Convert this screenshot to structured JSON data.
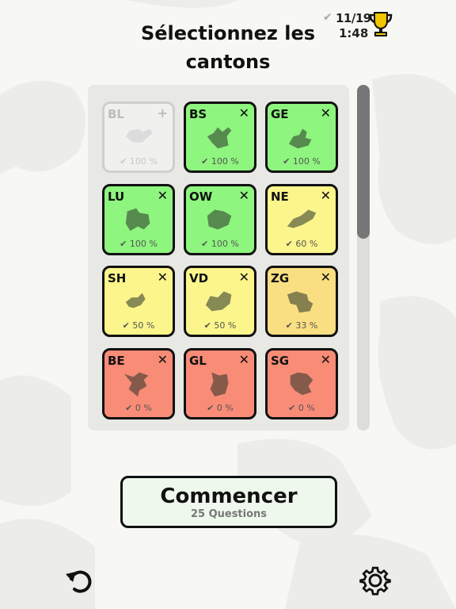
{
  "header": {
    "title": "Sélectionnez les cantons",
    "score": "11/19",
    "time": "1:48",
    "check_icon": "check-icon",
    "trophy_icon": "trophy-icon"
  },
  "tiles": [
    {
      "code": "BL",
      "action": "+",
      "percent": "✔ 100 %",
      "state": "disabled"
    },
    {
      "code": "BS",
      "action": "✕",
      "percent": "✔ 100 %",
      "state": "green"
    },
    {
      "code": "GE",
      "action": "✕",
      "percent": "✔ 100 %",
      "state": "green"
    },
    {
      "code": "LU",
      "action": "✕",
      "percent": "✔ 100 %",
      "state": "green"
    },
    {
      "code": "OW",
      "action": "✕",
      "percent": "✔ 100 %",
      "state": "green"
    },
    {
      "code": "NE",
      "action": "✕",
      "percent": "✔ 60 %",
      "state": "yellow"
    },
    {
      "code": "SH",
      "action": "✕",
      "percent": "✔ 50 %",
      "state": "yellow"
    },
    {
      "code": "VD",
      "action": "✕",
      "percent": "✔ 50 %",
      "state": "yellow"
    },
    {
      "code": "ZG",
      "action": "✕",
      "percent": "✔ 33 %",
      "state": "orange"
    },
    {
      "code": "BE",
      "action": "✕",
      "percent": "✔ 0 %",
      "state": "red"
    },
    {
      "code": "GL",
      "action": "✕",
      "percent": "✔ 0 %",
      "state": "red"
    },
    {
      "code": "SG",
      "action": "✕",
      "percent": "✔ 0 %",
      "state": "red"
    }
  ],
  "start_button": {
    "label": "Commencer",
    "sub": "25 Questions"
  },
  "footer": {
    "undo_icon": "undo-icon",
    "settings_icon": "gear-icon"
  },
  "colors": {
    "green": "#8ef57e",
    "yellow": "#fbf58c",
    "orange": "#f9df82",
    "red": "#f88c77",
    "trophy": "#f2c500"
  }
}
